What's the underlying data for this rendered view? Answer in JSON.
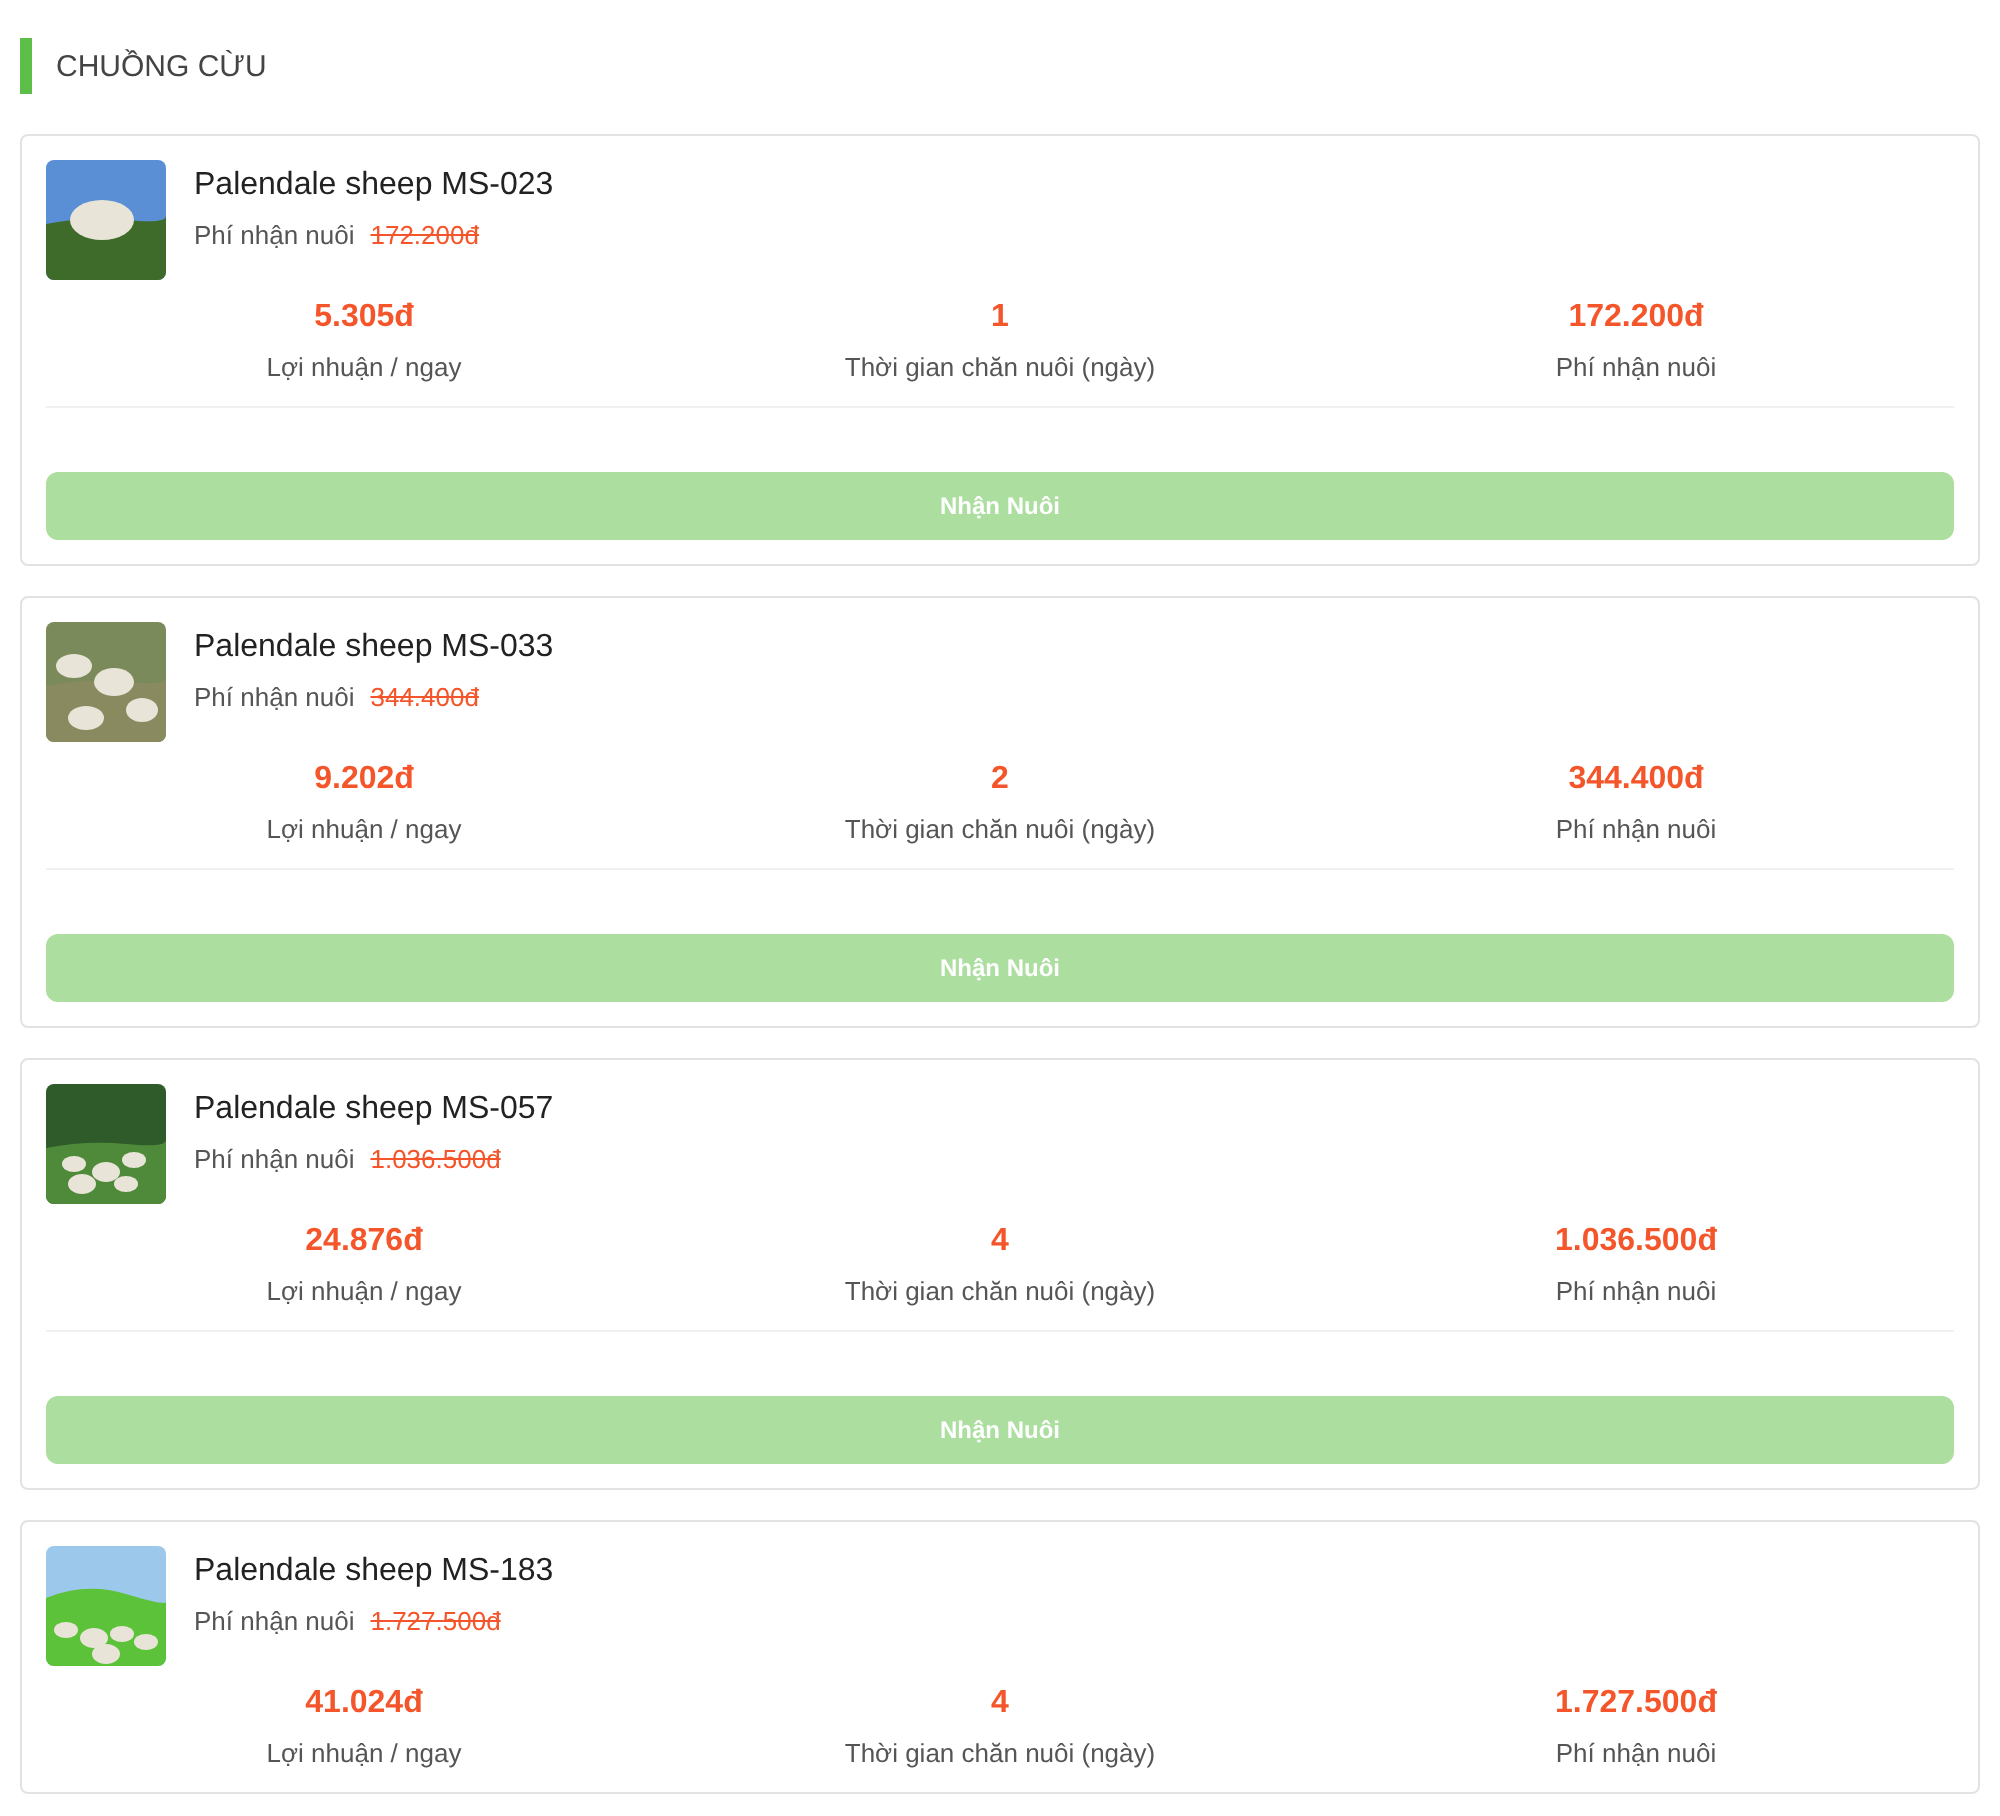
{
  "section_title": "CHUỒNG CỪU",
  "cards": [
    {
      "name": "Palendale sheep MS-023",
      "fee_label": "Phí nhận nuôi",
      "old_price": "172.200đ",
      "stats": [
        {
          "value": "5.305đ",
          "label": "Lợi nhuận / ngay"
        },
        {
          "value": "1",
          "label": "Thời gian chăn nuôi (ngày)"
        },
        {
          "value": "172.200đ",
          "label": "Phí nhận nuôi"
        }
      ],
      "button": "Nhận Nuôi"
    },
    {
      "name": "Palendale sheep MS-033",
      "fee_label": "Phí nhận nuôi",
      "old_price": "344.400đ",
      "stats": [
        {
          "value": "9.202đ",
          "label": "Lợi nhuận / ngay"
        },
        {
          "value": "2",
          "label": "Thời gian chăn nuôi (ngày)"
        },
        {
          "value": "344.400đ",
          "label": "Phí nhận nuôi"
        }
      ],
      "button": "Nhận Nuôi"
    },
    {
      "name": "Palendale sheep MS-057",
      "fee_label": "Phí nhận nuôi",
      "old_price": "1.036.500đ",
      "stats": [
        {
          "value": "24.876đ",
          "label": "Lợi nhuận / ngay"
        },
        {
          "value": "4",
          "label": "Thời gian chăn nuôi (ngày)"
        },
        {
          "value": "1.036.500đ",
          "label": "Phí nhận nuôi"
        }
      ],
      "button": "Nhận Nuôi"
    },
    {
      "name": "Palendale sheep MS-183",
      "fee_label": "Phí nhận nuôi",
      "old_price": "1.727.500đ",
      "stats": [
        {
          "value": "41.024đ",
          "label": "Lợi nhuận / ngay"
        },
        {
          "value": "4",
          "label": "Thời gian chăn nuôi (ngày)"
        },
        {
          "value": "1.727.500đ",
          "label": "Phí nhận nuôi"
        }
      ]
    }
  ]
}
